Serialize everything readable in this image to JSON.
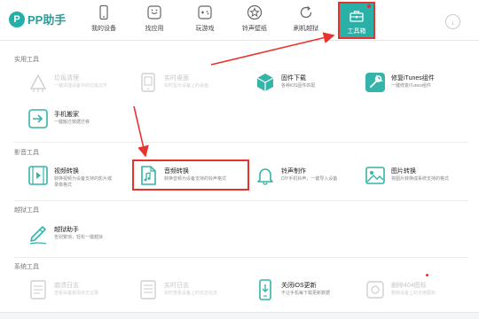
{
  "app": {
    "logo_mark": "P",
    "logo_text": "PP助手"
  },
  "nav": {
    "tabs": [
      {
        "label": "我的设备",
        "icon": "phone-icon"
      },
      {
        "label": "找应用",
        "icon": "app-store-icon"
      },
      {
        "label": "玩游戏",
        "icon": "gamepad-icon"
      },
      {
        "label": "铃声壁纸",
        "icon": "star-icon"
      },
      {
        "label": "刷机越狱",
        "icon": "refresh-icon"
      },
      {
        "label": "工具箱",
        "icon": "toolbox-icon",
        "active": true
      }
    ],
    "download_icon": "↓"
  },
  "sections": {
    "common": "实用工具",
    "media": "影音工具",
    "jailbreak": "越狱工具",
    "system": "系统工具"
  },
  "tools": {
    "junk_clean": {
      "name": "垃圾清理",
      "desc": "一键清理设备中的垃圾文件"
    },
    "live_desktop": {
      "name": "实时桌面",
      "desc": "实时显示设备上的桌面"
    },
    "firmware": {
      "name": "固件下载",
      "desc": "各种iOS固件匹配"
    },
    "itunes_fix": {
      "name": "修复iTunes组件",
      "desc": "一键修复iTunes组件"
    },
    "phone_move": {
      "name": "手机搬家",
      "desc": "一键搬迁数据迁移"
    },
    "video_convert": {
      "name": "视频转换",
      "desc": "转换视频为设备支持的影片或",
      "desc2": "录像格式"
    },
    "audio_convert": {
      "name": "音频转换",
      "desc": "转换音频为设备支持的铃声格式"
    },
    "ringtone_make": {
      "name": "铃声制作",
      "desc": "DIY手机铃声，一键导入设备"
    },
    "image_convert": {
      "name": "图片转换",
      "desc": "将图片转换成系统支持的格式"
    },
    "jailbreak_helper": {
      "name": "越狱助手",
      "desc": "告别繁琐，轻松一键越狱"
    },
    "crash_log": {
      "name": "崩溃日志",
      "desc": "查看设备崩溃日志记录"
    },
    "live_log": {
      "name": "实时日志",
      "desc": "实时查看设备上的日志信息"
    },
    "close_ios_update": {
      "name": "关闭iOS更新",
      "desc": "不让手机每下载更新数据"
    },
    "delete_icon": {
      "name": "删除404图标",
      "desc": "删除设备上的无用图标"
    }
  },
  "colors": {
    "accent": "#2ab0a6",
    "annotation": "#e8322d"
  }
}
